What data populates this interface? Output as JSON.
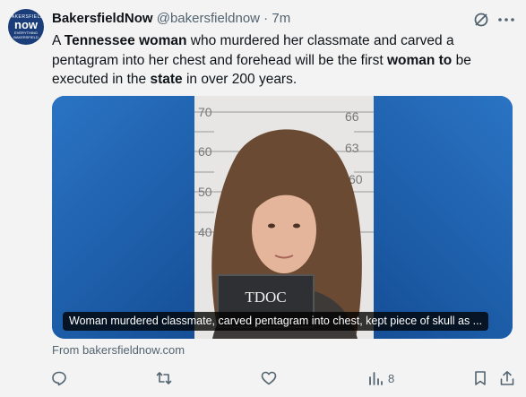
{
  "account": {
    "avatar_line1": "BAKERSFIELD",
    "avatar_line2": "now",
    "avatar_line3": "EVERYTHING",
    "avatar_line4": "BAKERSFIELD",
    "name": "BakersfieldNow",
    "handle": "@bakersfieldnow",
    "separator": " · ",
    "time": "7m"
  },
  "tweet": {
    "t1": "A ",
    "b1": "Tennessee woman",
    "t2": " who murdered her classmate and carved a pentagram into her chest and forehead will be the first ",
    "b2": "woman to",
    "t3": " be executed in the ",
    "b3": "state",
    "t4": " in over 200 years."
  },
  "media": {
    "board_text": "TDOC",
    "height_marks": [
      "70",
      "60",
      "50",
      "40",
      "66",
      "63",
      "60"
    ],
    "caption": "Woman murdered classmate, carved pentagram into chest, kept piece of skull as ..."
  },
  "source": "From bakersfieldnow.com",
  "actions": {
    "views": "8"
  },
  "icons": {
    "grok": "grok-icon",
    "more": "more-icon",
    "reply": "reply-icon",
    "retweet": "retweet-icon",
    "like": "like-icon",
    "views": "views-icon",
    "bookmark": "bookmark-icon",
    "share": "share-icon"
  }
}
